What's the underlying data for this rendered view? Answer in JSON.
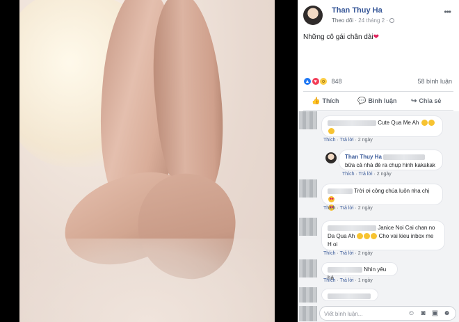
{
  "post": {
    "author": "Than Thuy Ha",
    "follow_label": "Theo dõi",
    "date": "24 tháng 2",
    "caption": "Những cô gái chân dài",
    "caption_emoji": "❤",
    "more_glyph": "•••"
  },
  "stats": {
    "reaction_count": "848",
    "comment_count": "58 bình luận"
  },
  "actions": {
    "like": "Thích",
    "comment": "Bình luận",
    "share": "Chia sẻ"
  },
  "comments": [
    {
      "text": "Cute Qua Me Ah",
      "like": "Thích",
      "reply": "Trả lời",
      "time": "2 ngày"
    },
    {
      "author": "Than Thuy Ha",
      "text": "bữa cả nhà đè ra chụp hình kakakak",
      "like": "Thích",
      "reply": "Trả lời",
      "time": "2 ngày"
    },
    {
      "text": "Trời ơi công chúa luôn nha chị",
      "like": "Thích",
      "reply": "Trả lời",
      "time": "2 ngày"
    },
    {
      "text_a": "Janice Noi Cai chan no",
      "text_b": "Da Qua Ah",
      "text_c": "Cho vai kieu inbox me",
      "text_d": "H oi",
      "like": "Thích",
      "reply": "Trả lời",
      "time": "2 ngày"
    },
    {
      "text": "Nhìn yêu há",
      "like": "Thích",
      "reply": "Trả lời",
      "time": "1 ngày"
    }
  ],
  "composer": {
    "placeholder": "Viết bình luận..."
  },
  "icons": {
    "like": "thumbs-up-icon",
    "comment": "comment-icon",
    "share": "share-icon",
    "public": "globe-icon"
  },
  "colors": {
    "link": "#385898",
    "muted": "#90949c",
    "like_blue": "#2078f4",
    "love_red": "#f33e58"
  }
}
